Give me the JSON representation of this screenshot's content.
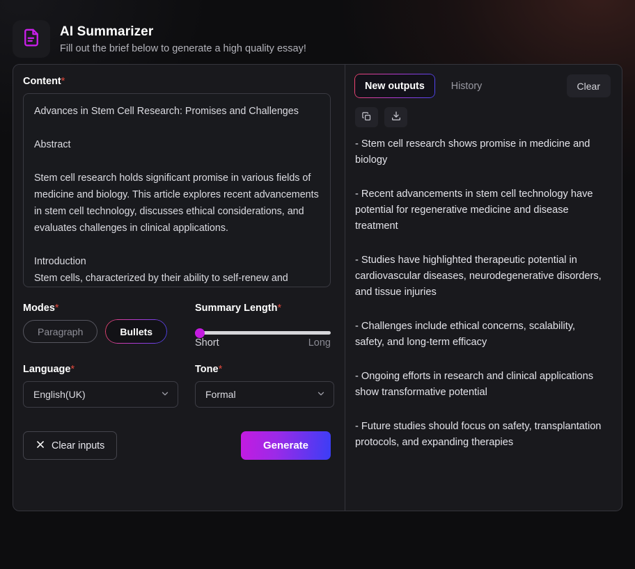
{
  "header": {
    "logo_icon": "document-icon",
    "title": "AI Summarizer",
    "subtitle": "Fill out the brief below to generate a high quality essay!"
  },
  "colors": {
    "accent_magenta": "#c41be0",
    "accent_blue": "#3b3ef5",
    "accent_pink": "#f2456b",
    "required_red": "#e0483c",
    "page_bg": "#0d0d0f",
    "card_bg": "#19191d"
  },
  "form": {
    "content": {
      "label": "Content",
      "required_mark": "*",
      "value": "Advances in Stem Cell Research: Promises and Challenges\n\nAbstract\n\nStem cell research holds significant promise in various fields of medicine and biology. This article explores recent advancements in stem cell technology, discusses ethical considerations, and evaluates challenges in clinical applications.\n\nIntroduction\nStem cells, characterized by their ability to self-renew and"
    },
    "modes": {
      "label": "Modes",
      "required_mark": "*",
      "options": [
        "Paragraph",
        "Bullets"
      ],
      "selected": "Bullets",
      "paragraph_label": "Paragraph",
      "bullets_label": "Bullets"
    },
    "summary_length": {
      "label": "Summary Length",
      "required_mark": "*",
      "min_label": "Short",
      "max_label": "Long",
      "value_percent": 0
    },
    "language": {
      "label": "Language",
      "required_mark": "*",
      "selected": "English(UK)",
      "chevron_icon": "chevron-down-icon"
    },
    "tone": {
      "label": "Tone",
      "required_mark": "*",
      "selected": "Formal",
      "chevron_icon": "chevron-down-icon"
    },
    "clear_inputs_label": "Clear inputs",
    "clear_inputs_icon": "close-x-icon",
    "generate_label": "Generate"
  },
  "output": {
    "tabs": [
      {
        "label": "New outputs",
        "active": true
      },
      {
        "label": "History",
        "active": false
      }
    ],
    "tab_new_label": "New outputs",
    "tab_history_label": "History",
    "clear_label": "Clear",
    "copy_icon": "copy-icon",
    "download_icon": "download-icon",
    "bullets": [
      "- Stem cell research shows promise in medicine and biology",
      "- Recent advancements in stem cell technology have potential for regenerative medicine and disease treatment",
      "- Studies have highlighted therapeutic potential in cardiovascular diseases, neurodegenerative disorders, and tissue injuries",
      "- Challenges include ethical concerns, scalability, safety, and long-term efficacy",
      "- Ongoing efforts in research and clinical applications show transformative potential",
      "- Future studies should focus on safety, transplantation protocols, and expanding therapies"
    ]
  }
}
